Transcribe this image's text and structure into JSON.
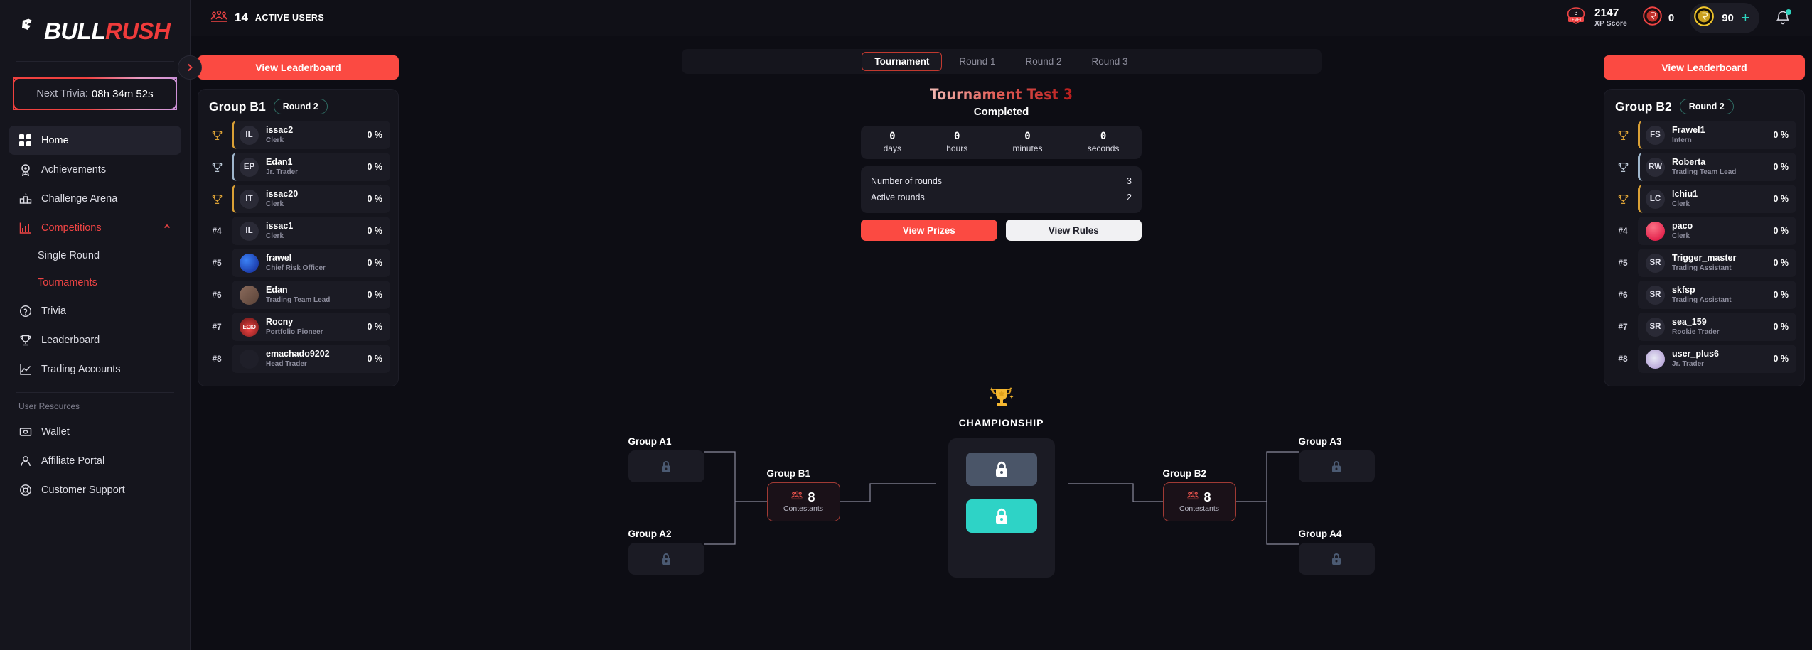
{
  "brand": {
    "name_white": "BULL",
    "name_red": "RUSH"
  },
  "sidebar": {
    "trivia": {
      "label": "Next Trivia:",
      "time": "08h 34m 52s"
    },
    "items": [
      {
        "label": "Home",
        "icon": "grid-icon",
        "active": true
      },
      {
        "label": "Achievements",
        "icon": "medal-icon",
        "active": false
      },
      {
        "label": "Challenge Arena",
        "icon": "podium-icon",
        "active": false
      },
      {
        "label": "Competitions",
        "icon": "bar-chart-icon",
        "active": false,
        "accent": true,
        "expanded": true
      }
    ],
    "competitions_sub": [
      {
        "label": "Single Round",
        "accent": false
      },
      {
        "label": "Tournaments",
        "accent": true
      }
    ],
    "items_after": [
      {
        "label": "Trivia",
        "icon": "question-circle-icon"
      },
      {
        "label": "Leaderboard",
        "icon": "trophy-icon"
      },
      {
        "label": "Trading Accounts",
        "icon": "line-chart-icon"
      }
    ],
    "resources_label": "User Resources",
    "resources": [
      {
        "label": "Wallet",
        "icon": "wallet-icon"
      },
      {
        "label": "Affiliate Portal",
        "icon": "person-icon"
      },
      {
        "label": "Customer Support",
        "icon": "support-icon"
      }
    ]
  },
  "topbar": {
    "active_users_count": "14",
    "active_users_label": "ACTIVE USERS",
    "level_number": "3",
    "level_word": "LEVEL",
    "xp_value": "2147",
    "xp_label": "XP Score",
    "red_coin_value": "0",
    "gold_coin_value": "90",
    "plus_label": "+"
  },
  "leaderboard_left": {
    "button_label": "View Leaderboard",
    "title": "Group B1",
    "round_chip": "Round 2",
    "rows": [
      {
        "rank": "1",
        "medal": "gold",
        "initials": "IL",
        "avatar": "initials",
        "name": "issac2",
        "role": "Clerk",
        "pct": "0 %"
      },
      {
        "rank": "2",
        "medal": "silver",
        "initials": "EP",
        "avatar": "initials",
        "name": "Edan1",
        "role": "Jr. Trader",
        "pct": "0 %"
      },
      {
        "rank": "3",
        "medal": "bronze",
        "initials": "IT",
        "avatar": "initials",
        "name": "issac20",
        "role": "Clerk",
        "pct": "0 %"
      },
      {
        "rank": "#4",
        "medal": "",
        "initials": "IL",
        "avatar": "initials",
        "name": "issac1",
        "role": "Clerk",
        "pct": "0 %"
      },
      {
        "rank": "#5",
        "medal": "",
        "initials": "",
        "avatar": "img-blue",
        "name": "frawel",
        "role": "Chief Risk Officer",
        "pct": "0 %"
      },
      {
        "rank": "#6",
        "medal": "",
        "initials": "",
        "avatar": "img-brown",
        "name": "Edan",
        "role": "Trading Team Lead",
        "pct": "0 %"
      },
      {
        "rank": "#7",
        "medal": "",
        "initials": "EGIO",
        "avatar": "img-redglow",
        "name": "Rocny",
        "role": "Portfolio Pioneer",
        "pct": "0 %"
      },
      {
        "rank": "#8",
        "medal": "",
        "initials": "",
        "avatar": "img-dark",
        "name": "emachado9202",
        "role": "Head Trader",
        "pct": "0 %"
      }
    ]
  },
  "leaderboard_right": {
    "button_label": "View Leaderboard",
    "title": "Group B2",
    "round_chip": "Round 2",
    "rows": [
      {
        "rank": "1",
        "medal": "gold",
        "initials": "FS",
        "avatar": "initials",
        "name": "Frawel1",
        "role": "Intern",
        "pct": "0 %"
      },
      {
        "rank": "2",
        "medal": "silver",
        "initials": "RW",
        "avatar": "initials",
        "name": "Roberta",
        "role": "Trading Team Lead",
        "pct": "0 %"
      },
      {
        "rank": "3",
        "medal": "bronze",
        "initials": "LC",
        "avatar": "initials",
        "name": "lchiu1",
        "role": "Clerk",
        "pct": "0 %"
      },
      {
        "rank": "#4",
        "medal": "",
        "initials": "",
        "avatar": "img-pink",
        "name": "paco",
        "role": "Clerk",
        "pct": "0 %"
      },
      {
        "rank": "#5",
        "medal": "",
        "initials": "SR",
        "avatar": "initials",
        "name": "Trigger_master",
        "role": "Trading Assistant",
        "pct": "0 %"
      },
      {
        "rank": "#6",
        "medal": "",
        "initials": "SR",
        "avatar": "initials",
        "name": "skfsp",
        "role": "Trading Assistant",
        "pct": "0 %"
      },
      {
        "rank": "#7",
        "medal": "",
        "initials": "SR",
        "avatar": "initials",
        "name": "sea_159",
        "role": "Rookie Trader",
        "pct": "0 %"
      },
      {
        "rank": "#8",
        "medal": "",
        "initials": "",
        "avatar": "img-white",
        "name": "user_plus6",
        "role": "Jr. Trader",
        "pct": "0 %"
      }
    ]
  },
  "tabs": [
    {
      "label": "Tournament",
      "active": true
    },
    {
      "label": "Round 1",
      "active": false
    },
    {
      "label": "Round 2",
      "active": false
    },
    {
      "label": "Round 3",
      "active": false
    }
  ],
  "tournament": {
    "title": "Tournament Test 3",
    "status": "Completed",
    "countdown": [
      {
        "value": "0",
        "unit": "days"
      },
      {
        "value": "0",
        "unit": "hours"
      },
      {
        "value": "0",
        "unit": "minutes"
      },
      {
        "value": "0",
        "unit": "seconds"
      }
    ],
    "info": [
      {
        "label": "Number of rounds",
        "value": "3"
      },
      {
        "label": "Active rounds",
        "value": "2"
      }
    ],
    "prizes_label": "View Prizes",
    "rules_label": "View Rules"
  },
  "bracket": {
    "championship_label": "CHAMPIONSHIP",
    "contestants_label": "Contestants",
    "nodes": [
      {
        "label": "Group A1",
        "type": "locked"
      },
      {
        "label": "Group A2",
        "type": "locked"
      },
      {
        "label": "Group A3",
        "type": "locked"
      },
      {
        "label": "Group A4",
        "type": "locked"
      },
      {
        "label": "Group B1",
        "type": "contestants",
        "count": "8"
      },
      {
        "label": "Group B2",
        "type": "contestants",
        "count": "8"
      }
    ]
  },
  "colors": {
    "accent_red": "#fb4a42",
    "teal": "#2ed3c6",
    "gold": "#d9a036",
    "bg": "#0d0d14",
    "panel": "#15151d"
  }
}
